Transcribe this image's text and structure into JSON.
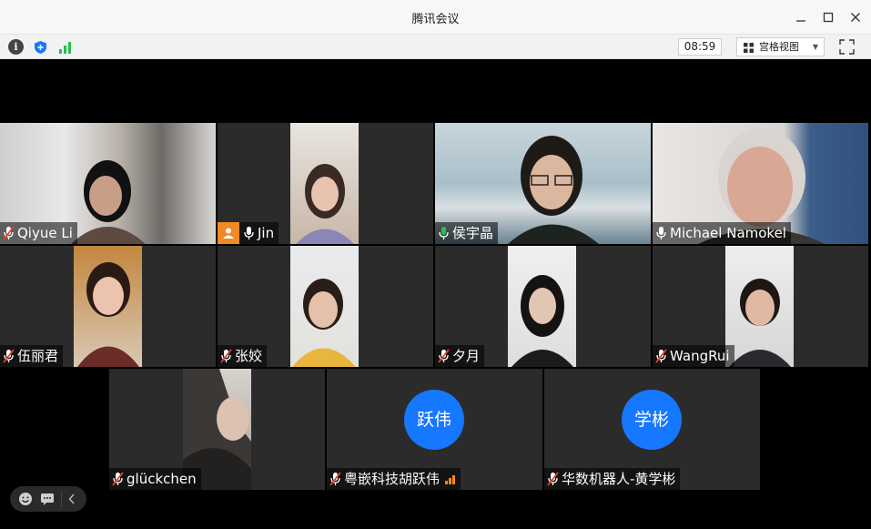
{
  "window": {
    "title": "腾讯会议"
  },
  "toolbar": {
    "timer": "08:59",
    "view_mode": "宫格视图"
  },
  "participants": [
    {
      "name": "Qiyue Li",
      "muted": true
    },
    {
      "name": "Jin",
      "muted": false
    },
    {
      "name": "侯宇晶",
      "muted": false,
      "speaking": true
    },
    {
      "name": "Michael Namokel",
      "muted": false
    },
    {
      "name": "伍丽君",
      "muted": true
    },
    {
      "name": "张姣",
      "muted": true
    },
    {
      "name": "夕月",
      "muted": true
    },
    {
      "name": "WangRui",
      "muted": true
    },
    {
      "name": "glückchen",
      "muted": true
    },
    {
      "name": "粤嵌科技胡跃伟",
      "muted": true,
      "avatar_text": "跃伟"
    },
    {
      "name": "华数机器人-黄学彬",
      "muted": true,
      "avatar_text": "学彬"
    }
  ],
  "colors": {
    "accent": "#1677ff",
    "active_border": "#27c14c",
    "muted_mic": "#e8412c",
    "host_badge": "#f08a24"
  }
}
